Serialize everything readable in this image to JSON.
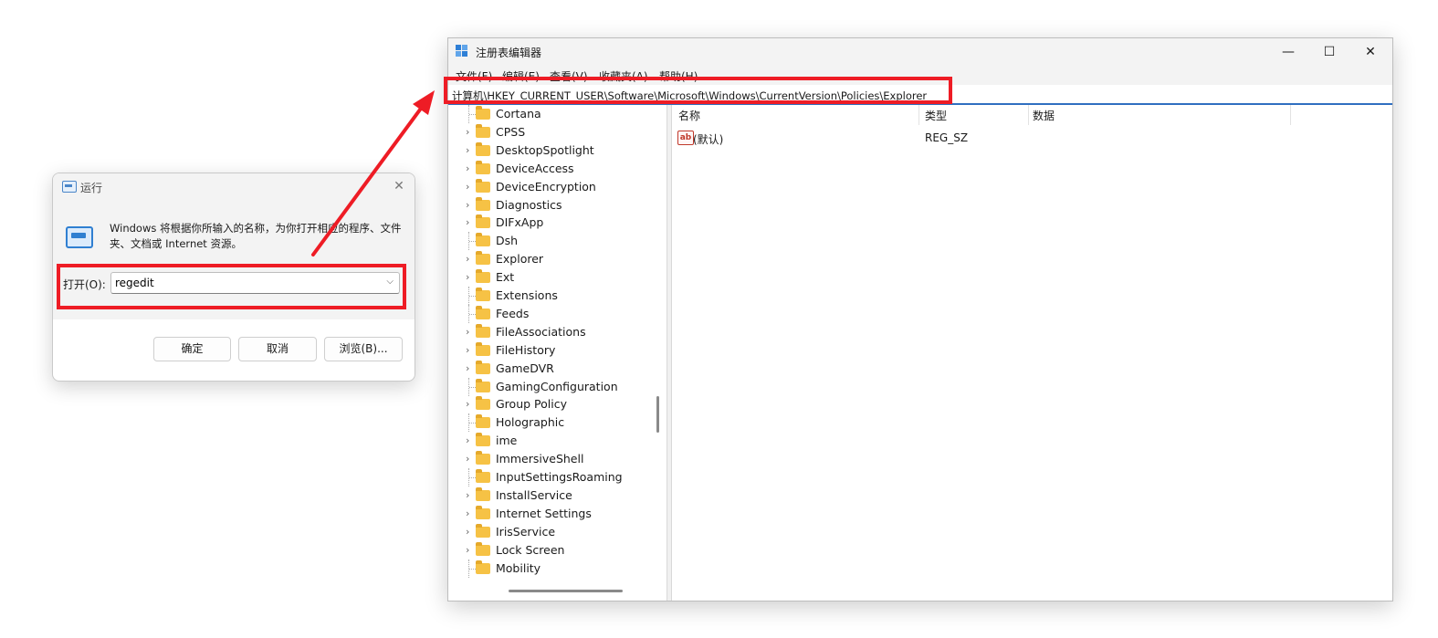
{
  "run_dialog": {
    "title": "运行",
    "close_glyph": "✕",
    "description": "Windows 将根据你所输入的名称，为你打开相应的程序、文件夹、文档或 Internet 资源。",
    "open_label": "打开(O):",
    "input_value": "regedit",
    "dropdown_glyph": "⌵",
    "buttons": {
      "ok": "确定",
      "cancel": "取消",
      "browse": "浏览(B)..."
    }
  },
  "regedit": {
    "title": "注册表编辑器",
    "window_controls": {
      "minimize": "—",
      "maximize": "☐",
      "close": "✕"
    },
    "menu": [
      "文件(F)",
      "编辑(E)",
      "查看(V)",
      "收藏夹(A)",
      "帮助(H)"
    ],
    "address": "计算机\\HKEY_CURRENT_USER\\Software\\Microsoft\\Windows\\CurrentVersion\\Policies\\Explorer",
    "tree_items": [
      {
        "label": "Cortana",
        "expandable": false
      },
      {
        "label": "CPSS",
        "expandable": true
      },
      {
        "label": "DesktopSpotlight",
        "expandable": true
      },
      {
        "label": "DeviceAccess",
        "expandable": true
      },
      {
        "label": "DeviceEncryption",
        "expandable": true
      },
      {
        "label": "Diagnostics",
        "expandable": true
      },
      {
        "label": "DIFxApp",
        "expandable": true
      },
      {
        "label": "Dsh",
        "expandable": false
      },
      {
        "label": "Explorer",
        "expandable": true
      },
      {
        "label": "Ext",
        "expandable": true
      },
      {
        "label": "Extensions",
        "expandable": false
      },
      {
        "label": "Feeds",
        "expandable": false
      },
      {
        "label": "FileAssociations",
        "expandable": true
      },
      {
        "label": "FileHistory",
        "expandable": true
      },
      {
        "label": "GameDVR",
        "expandable": true
      },
      {
        "label": "GamingConfiguration",
        "expandable": false
      },
      {
        "label": "Group Policy",
        "expandable": true
      },
      {
        "label": "Holographic",
        "expandable": false
      },
      {
        "label": "ime",
        "expandable": true
      },
      {
        "label": "ImmersiveShell",
        "expandable": true
      },
      {
        "label": "InputSettingsRoaming",
        "expandable": false
      },
      {
        "label": "InstallService",
        "expandable": true
      },
      {
        "label": "Internet Settings",
        "expandable": true
      },
      {
        "label": "IrisService",
        "expandable": true
      },
      {
        "label": "Lock Screen",
        "expandable": true
      },
      {
        "label": "Mobility",
        "expandable": false
      }
    ],
    "columns": {
      "name": "名称",
      "type": "类型",
      "data": "数据"
    },
    "values": [
      {
        "icon": "ab",
        "name": "(默认)",
        "type": "REG_SZ",
        "data": ""
      }
    ]
  },
  "colors": {
    "highlight": "#ee1c25",
    "accent": "#2f6fc0",
    "folder": "#f6c245"
  }
}
